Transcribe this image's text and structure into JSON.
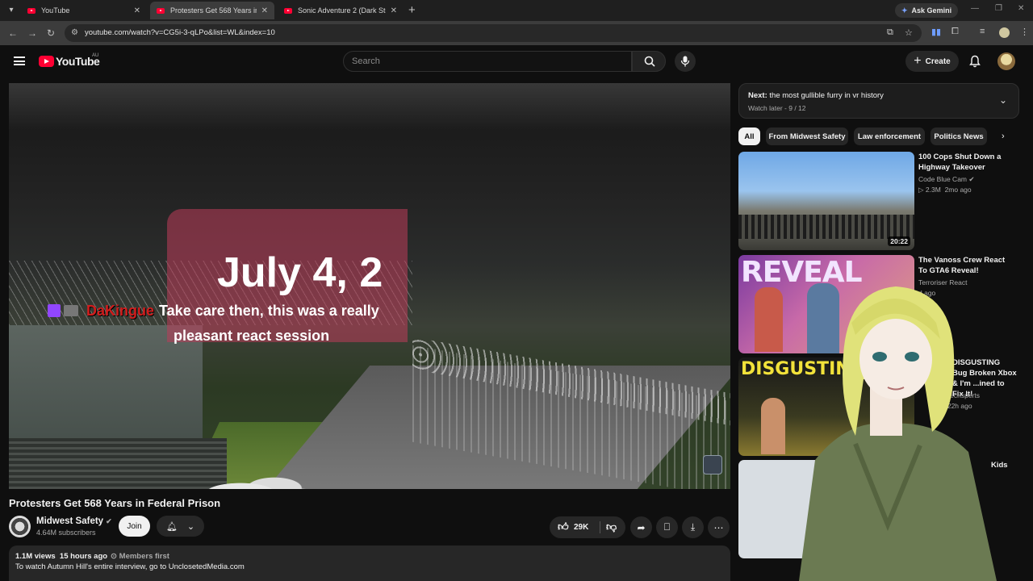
{
  "browser": {
    "tabs": [
      {
        "label": "YouTube",
        "active": false
      },
      {
        "label": "Protesters Get 568 Years in Fede",
        "active": true
      },
      {
        "label": "Sonic Adventure 2 (Dark Story",
        "active": false
      }
    ],
    "ask_gemini": "Ask Gemini",
    "url": "youtube.com/watch?v=CG5i-3-qLPo&list=WL&index=10"
  },
  "youtube": {
    "logo_text": "YouTube",
    "country_code": "AU",
    "search_placeholder": "Search",
    "create_label": "Create"
  },
  "video": {
    "overlay_date": "July 4, 2",
    "chat_user": "DaKingue",
    "chat_message_line1": "Take care then, this was a really",
    "chat_message_line2": "pleasant react session",
    "title": "Protesters Get 568 Years in Federal Prison",
    "channel": "Midwest Safety",
    "subscribers": "4.64M subscribers",
    "join_label": "Join",
    "likes": "29K",
    "views": "1.1M views",
    "age": "15 hours ago",
    "members_first": "Members first",
    "description": "To watch Autumn Hill's entire interview, go to UnclosetedMedia.com"
  },
  "playlist": {
    "next_prefix": "Next:",
    "next_title": "the most gullible furry in vr history",
    "playlist_info": "Watch later - 9 / 12"
  },
  "chips": [
    "All",
    "From Midwest Safety",
    "Law enforcement",
    "Politics News"
  ],
  "recommendations": [
    {
      "title": "100 Cops Shut Down a Highway Takeover",
      "channel": "Code Blue Cam",
      "views": "2.3M",
      "age": "2mo ago",
      "duration": "20:22"
    },
    {
      "title": "The Vanoss Crew React To GTA6 Reveal!",
      "channel": "Terroriser React",
      "meta": "d ago",
      "thumb_text": "REVEAL"
    },
    {
      "title": "DISGUSTING Bug Broken Xbox & I'm ...ined to Fix It!",
      "channel": "lem Techsperts",
      "meta": "11K  22h ago",
      "thumb_text": "DISGUSTING XB"
    },
    {
      "title": "Kids",
      "channel": "",
      "meta": ""
    }
  ],
  "colors": {
    "brand_red": "#ff0033",
    "background": "#0f0f0f",
    "chip_bg": "#272727",
    "chat_user": "#d11d1d",
    "twitch": "#9146ff"
  }
}
